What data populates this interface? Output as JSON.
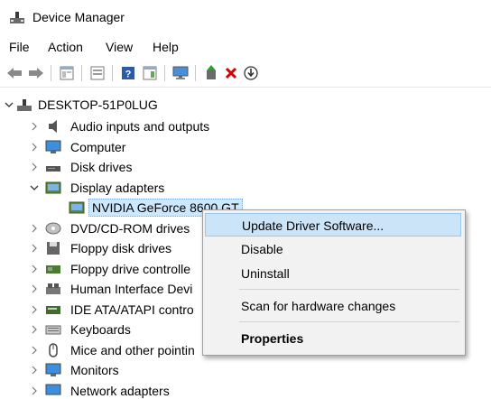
{
  "window": {
    "title": "Device Manager",
    "icon": "device-manager-icon"
  },
  "menu": [
    "File",
    "Action",
    "View",
    "Help"
  ],
  "toolbar": {
    "buttons": [
      "back-arrow-icon",
      "forward-arrow-icon",
      "properties-view-icon",
      "list-view-icon",
      "help-icon",
      "details-icon",
      "monitor-scan-icon",
      "update-driver-icon",
      "uninstall-x-icon",
      "download-circle-icon"
    ]
  },
  "tree": {
    "root": "DESKTOP-51P0LUG",
    "items": [
      {
        "label": "Audio inputs and outputs",
        "icon": "speaker-icon"
      },
      {
        "label": "Computer",
        "icon": "computer-icon"
      },
      {
        "label": "Disk drives",
        "icon": "disk-drive-icon"
      },
      {
        "label": "Display adapters",
        "icon": "display-adapter-icon"
      },
      {
        "label": "NVIDIA GeForce 8600 GT",
        "icon": "display-adapter-icon"
      },
      {
        "label": "DVD/CD-ROM drives",
        "icon": "dvd-icon"
      },
      {
        "label": "Floppy disk drives",
        "icon": "floppy-icon"
      },
      {
        "label": "Floppy drive controlle",
        "icon": "floppy-controller-icon"
      },
      {
        "label": "Human Interface Devi",
        "icon": "hid-icon"
      },
      {
        "label": "IDE ATA/ATAPI contro",
        "icon": "ide-icon"
      },
      {
        "label": "Keyboards",
        "icon": "keyboard-icon"
      },
      {
        "label": "Mice and other pointin",
        "icon": "mouse-icon"
      },
      {
        "label": "Monitors",
        "icon": "monitor-icon"
      },
      {
        "label": "Network adapters",
        "icon": "network-icon"
      }
    ]
  },
  "context_menu": {
    "items": [
      "Update Driver Software...",
      "Disable",
      "Uninstall",
      "Scan for hardware changes",
      "Properties"
    ]
  },
  "colors": {
    "selection": "#cce8ff",
    "menu_highlight": "#cce4f7",
    "accent_red": "#d40000",
    "accent_green": "#2e9e2e"
  }
}
